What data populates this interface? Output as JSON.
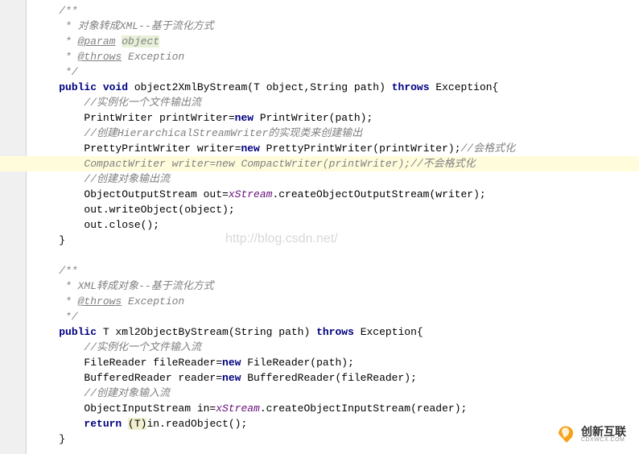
{
  "gutter_marker": "//",
  "code": {
    "l0": "    /**",
    "l1a": "     * ",
    "l1b": "对象转成XML--基于流化方式",
    "l2a": "     * ",
    "l2b": "@param",
    "l2c": " ",
    "l2d": "object",
    "l3a": "     * ",
    "l3b": "@throws",
    "l3c": " Exception",
    "l4": "     */",
    "l5a": "    ",
    "l5_public": "public",
    "l5b": " ",
    "l5_void": "void",
    "l5c": " object2XmlByStream(T object,String path) ",
    "l5_throws": "throws",
    "l5d": " Exception{",
    "l6": "        //实例化一个文件输出流",
    "l7a": "        PrintWriter printWriter=",
    "l7_new": "new",
    "l7b": " PrintWriter(path);",
    "l8": "        //创建HierarchicalStreamWriter的实现类来创建输出",
    "l9a": "        PrettyPrintWriter writer=",
    "l9_new": "new",
    "l9b": " PrettyPrintWriter(printWriter);",
    "l9c": "//会格式化",
    "l10a": "        CompactWriter writer=new CompactWriter(printWriter);",
    "l10b": "//不会格式化",
    "l11": "        //创建对象输出流",
    "l12a": "        ObjectOutputStream out=",
    "l12_field": "xStream",
    "l12b": ".createObjectOutputStream(writer);",
    "l13": "        out.writeObject(object);",
    "l14": "        out.close();",
    "l15": "    }",
    "l16": "",
    "l17": "    /**",
    "l18a": "     * ",
    "l18b": "XML转成对象--基于流化方式",
    "l19a": "     * ",
    "l19b": "@throws",
    "l19c": " Exception",
    "l20": "     */",
    "l21a": "    ",
    "l21_public": "public",
    "l21b": " T xml2ObjectByStream(String path) ",
    "l21_throws": "throws",
    "l21c": " Exception{",
    "l22": "        //实例化一个文件输入流",
    "l23a": "        FileReader fileReader=",
    "l23_new": "new",
    "l23b": " FileReader(path);",
    "l24a": "        BufferedReader reader=",
    "l24_new": "new",
    "l24b": " BufferedReader(fileReader);",
    "l25": "        //创建对象输入流",
    "l26a": "        ObjectInputStream in=",
    "l26_field": "xStream",
    "l26b": ".createObjectInputStream(reader);",
    "l27a": "        ",
    "l27_return": "return",
    "l27b": " ",
    "l27_cast": "(T)",
    "l27c": "in.readObject();",
    "l28": "    }"
  },
  "watermark": "http://blog.csdn.net/",
  "logo": {
    "main": "创新互联",
    "sub": "CDXWCX.COM"
  }
}
